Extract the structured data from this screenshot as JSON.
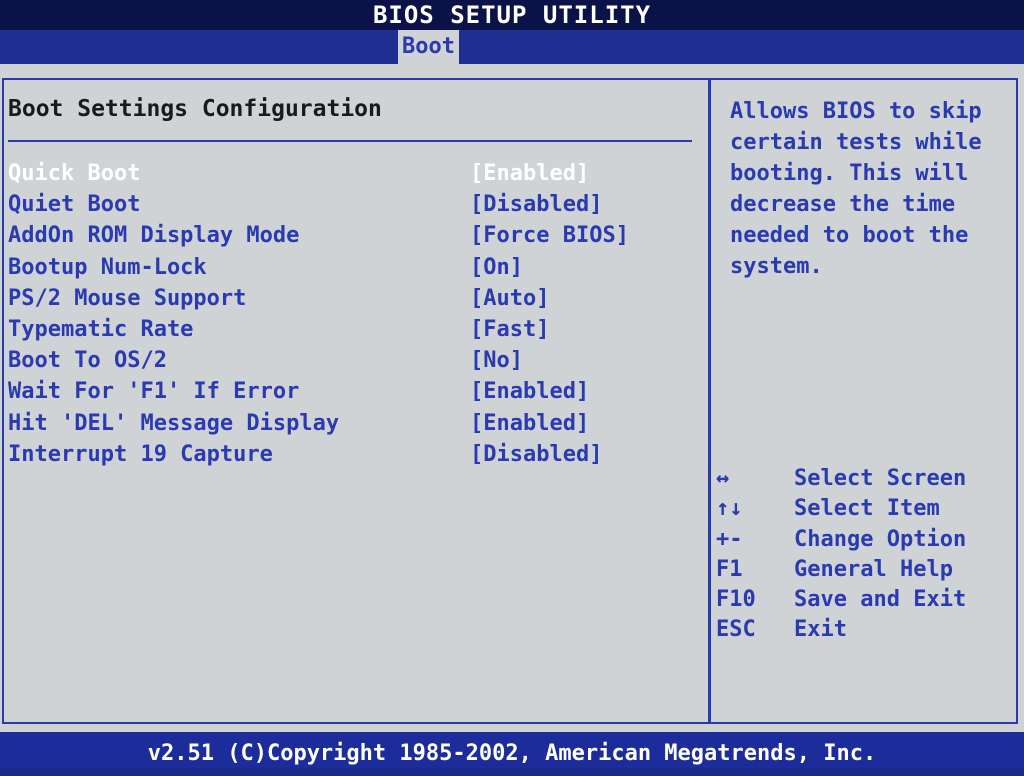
{
  "header": {
    "title": "BIOS SETUP UTILITY"
  },
  "tabs": [
    {
      "label": "Boot"
    }
  ],
  "main": {
    "section_title": "Boot Settings Configuration",
    "settings": [
      {
        "label": "Quick Boot",
        "value": "[Enabled]",
        "selected": true
      },
      {
        "label": "Quiet Boot",
        "value": "[Disabled]"
      },
      {
        "label": "AddOn ROM Display Mode",
        "value": "[Force BIOS]"
      },
      {
        "label": "Bootup Num-Lock",
        "value": "[On]"
      },
      {
        "label": "PS/2 Mouse Support",
        "value": "[Auto]"
      },
      {
        "label": "Typematic Rate",
        "value": "[Fast]"
      },
      {
        "label": "Boot To OS/2",
        "value": "[No]"
      },
      {
        "label": "Wait For 'F1' If Error",
        "value": "[Enabled]"
      },
      {
        "label": "Hit 'DEL' Message Display",
        "value": "[Enabled]"
      },
      {
        "label": "Interrupt 19 Capture",
        "value": "[Disabled]"
      }
    ]
  },
  "help": {
    "text": "Allows BIOS to skip\ncertain tests while\nbooting. This will\ndecrease the time\nneeded to boot the\nsystem.",
    "keys": [
      {
        "key": "↔",
        "desc": "Select Screen",
        "icon": "left-right-arrow-icon"
      },
      {
        "key": "↑↓",
        "desc": "Select Item",
        "icon": "up-down-arrow-icon"
      },
      {
        "key": "+-",
        "desc": "Change Option",
        "icon": "plus-minus-icon"
      },
      {
        "key": "F1",
        "desc": "General Help"
      },
      {
        "key": "F10",
        "desc": "Save and Exit"
      },
      {
        "key": "ESC",
        "desc": "Exit"
      }
    ]
  },
  "footer": {
    "copyright": "v2.51 (C)Copyright 1985-2002, American Megatrends, Inc."
  },
  "colors": {
    "background": "#cfd3d6",
    "accent": "#2a3ab0",
    "title_bar": "#0b1248",
    "selected_text": "#ffffff"
  }
}
